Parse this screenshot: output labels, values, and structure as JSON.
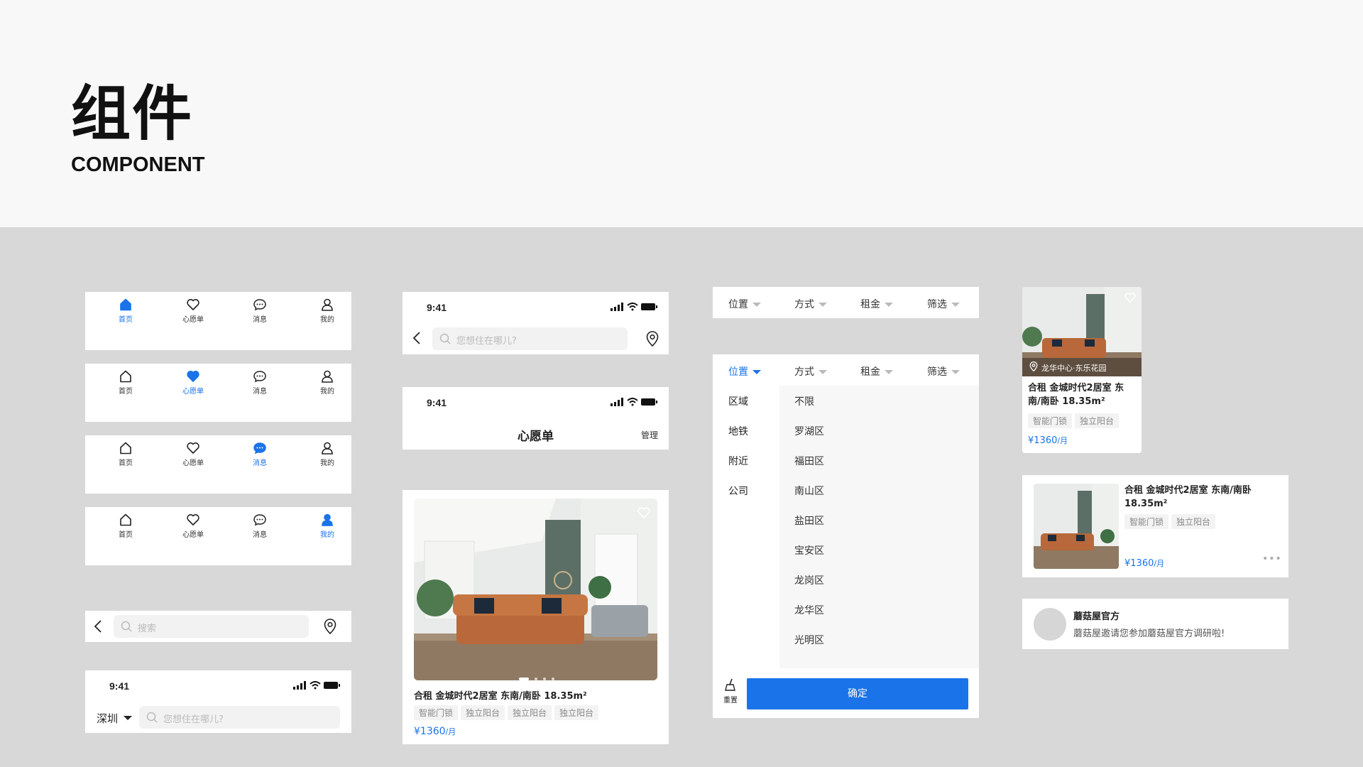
{
  "header": {
    "title_cn": "组件",
    "title_en": "COMPONENT"
  },
  "tabbar": {
    "items": [
      "首页",
      "心愿单",
      "消息",
      "我的"
    ]
  },
  "search_simple": {
    "placeholder": "搜索"
  },
  "status": {
    "time": "9:41"
  },
  "city_search": {
    "city": "深圳",
    "placeholder": "您想住在哪儿?"
  },
  "nav_search": {
    "placeholder": "您想住在哪儿?"
  },
  "wishlist_nav": {
    "title": "心愿单",
    "manage": "管理"
  },
  "listing_large": {
    "title": "合租 金城时代2居室 东南/南卧 18.35m²",
    "tags": [
      "智能门锁",
      "独立阳台",
      "独立阳台",
      "独立阳台"
    ],
    "price": "¥1360",
    "unit": "/月"
  },
  "filter_bar": {
    "items": [
      "位置",
      "方式",
      "租金",
      "筛选"
    ]
  },
  "filter_panel": {
    "left": [
      "区域",
      "地铁",
      "附近",
      "公司"
    ],
    "right": [
      "不限",
      "罗湖区",
      "福田区",
      "南山区",
      "盐田区",
      "宝安区",
      "龙岗区",
      "龙华区",
      "光明区"
    ],
    "reset": "重置",
    "confirm": "确定"
  },
  "listing_small": {
    "location": "龙华中心·东乐花园",
    "title": "合租 金城时代2居室 东南/南卧 18.35m²",
    "tags": [
      "智能门锁",
      "独立阳台"
    ],
    "price": "¥1360",
    "unit": "/月"
  },
  "listing_row": {
    "title": "合租 金城时代2居室 东南/南卧 18.35m²",
    "tags": [
      "智能门锁",
      "独立阳台"
    ],
    "price": "¥1360",
    "unit": "/月"
  },
  "message": {
    "name": "蘑菇屋官方",
    "text": "蘑菇屋邀请您参加蘑菇屋官方调研啦!"
  },
  "colors": {
    "accent": "#1a73e8",
    "page_bg": "#d8d8d8",
    "header_bg": "#f8f8f8"
  }
}
